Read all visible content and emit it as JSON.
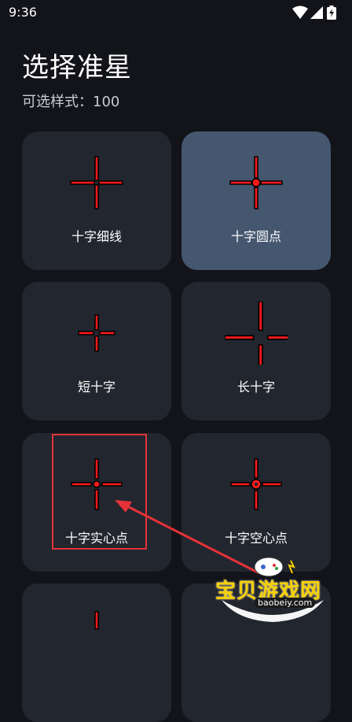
{
  "status_bar": {
    "time": "9:36"
  },
  "header": {
    "title": "选择准星",
    "subtitle": "可选样式：100"
  },
  "crosshairs": [
    {
      "label": "十字细线",
      "style": "cross-thin",
      "selected": false
    },
    {
      "label": "十字圆点",
      "style": "cross-dot",
      "selected": true
    },
    {
      "label": "短十字",
      "style": "short-cross",
      "selected": false
    },
    {
      "label": "长十字",
      "style": "long-cross",
      "selected": false
    },
    {
      "label": "十字实心点",
      "style": "cross-solid-dot",
      "selected": false
    },
    {
      "label": "十字空心点",
      "style": "cross-hollow-dot",
      "selected": false
    },
    {
      "label": "",
      "style": "partial",
      "selected": false
    },
    {
      "label": "",
      "style": "partial",
      "selected": false
    }
  ],
  "watermark": {
    "text": "宝贝游戏网",
    "url": "baobeiy.com"
  },
  "colors": {
    "background": "#131419",
    "card": "#22262e",
    "card_selected": "#45566f",
    "crosshair": "#ff1a1a",
    "highlight": "#e53238"
  }
}
